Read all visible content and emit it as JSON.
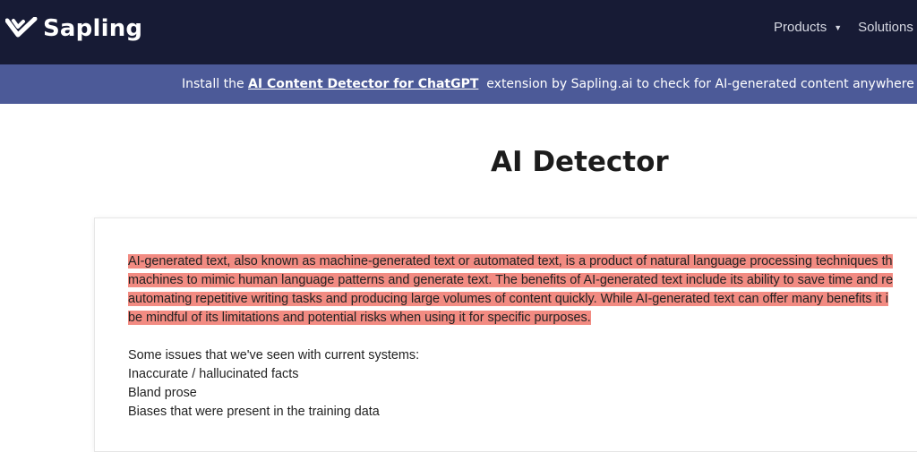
{
  "brand": {
    "name": "Sapling"
  },
  "nav": {
    "items": [
      {
        "label": "Products",
        "has_dropdown": true
      },
      {
        "label": "Solutions",
        "has_dropdown": false
      }
    ]
  },
  "banner": {
    "prefix": "Install the ",
    "link_text": "AI Content Detector for ChatGPT",
    "suffix": "  extension by Sapling.ai to check for AI-generated content anywhere on the in"
  },
  "page": {
    "title": "AI Detector"
  },
  "editor": {
    "highlighted_lines": [
      "AI-generated text, also known as machine-generated text or automated text, is a product of natural language processing techniques th",
      "machines to mimic human language patterns and generate text. The benefits of AI-generated text include its ability to save time and re",
      "automating repetitive writing tasks and producing large volumes of content quickly. While AI-generated text can offer many benefits it i",
      "be mindful of its limitations and potential risks when using it for specific purposes."
    ],
    "plain_lines": [
      "Some issues that we've seen with current systems:",
      "Inaccurate / hallucinated facts",
      "Bland prose",
      "Biases that were present in the training data"
    ]
  },
  "colors": {
    "navbar": "#171b35",
    "banner": "#4c5a98",
    "highlight": "#f28b82"
  }
}
